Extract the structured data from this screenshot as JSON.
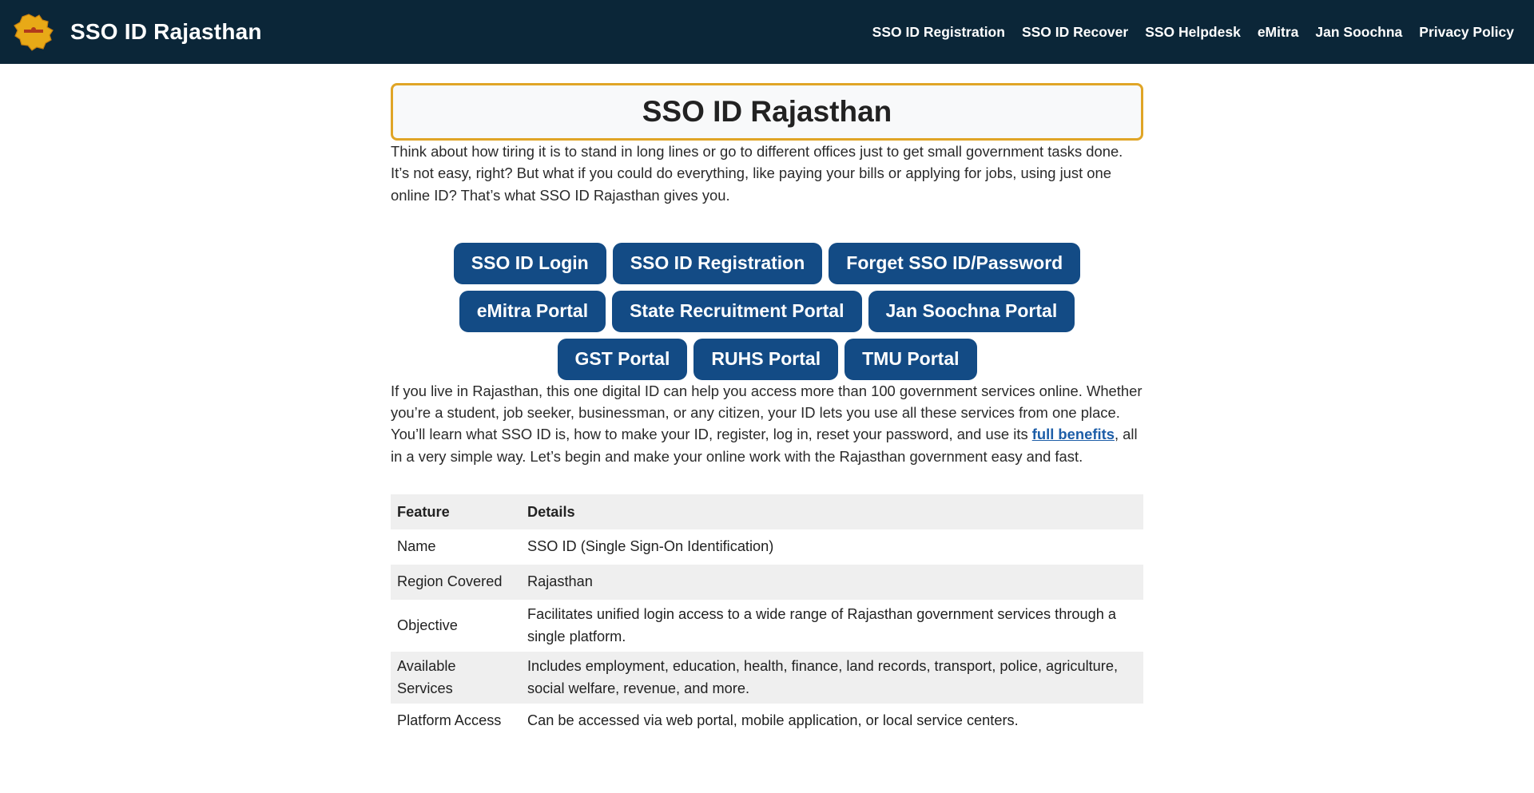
{
  "header": {
    "site_title": "SSO ID Rajasthan",
    "logo_icon": "rajasthan-map-logo",
    "nav": [
      "SSO ID Registration",
      "SSO ID Recover",
      "SSO Helpdesk",
      "eMitra",
      "Jan Soochna",
      "Privacy Policy"
    ]
  },
  "main": {
    "title": "SSO ID Rajasthan",
    "intro": "Think about how tiring it is to stand in long lines or go to different offices just to get small government tasks done. It’s not easy, right? But what if you could do everything, like paying your bills or applying for jobs, using just one online ID? That’s what SSO ID Rajasthan gives you.",
    "button_rows": [
      [
        "SSO ID Login",
        "SSO ID Registration",
        "Forget SSO ID/Password"
      ],
      [
        "eMitra Portal",
        "State Recruitment Portal",
        "Jan Soochna Portal"
      ],
      [
        "GST Portal",
        "RUHS Portal",
        "TMU Portal"
      ]
    ],
    "para2_before": "If you live in Rajasthan, this one digital ID can help you access more than 100 government services online. Whether you’re a student, job seeker, businessman, or any citizen, your ID lets you use all these services from one place. You’ll learn what SSO ID is, how to make your ID, register, log in, reset your password, and use its ",
    "para2_link": "full benefits",
    "para2_after": ", all in a very simple way. Let’s begin and make your online work with the Rajasthan government easy and fast.",
    "table": {
      "headers": [
        "Feature",
        "Details"
      ],
      "rows": [
        [
          "Name",
          "SSO ID (Single Sign-On Identification)"
        ],
        [
          "Region Covered",
          "Rajasthan"
        ],
        [
          "Objective",
          "Facilitates unified login access to a wide range of Rajasthan government services through a single platform."
        ],
        [
          "Available Services",
          "Includes employment, education, health, finance, land records, transport, police, agriculture, social welfare, revenue, and more."
        ],
        [
          "Platform Access",
          "Can be accessed via web portal, mobile application, or local service centers."
        ]
      ]
    }
  },
  "colors": {
    "header_bg": "#0b2638",
    "title_border": "#e0a526",
    "button_bg": "#134b85",
    "link": "#1d5ea8",
    "table_stripe": "#efefef"
  }
}
